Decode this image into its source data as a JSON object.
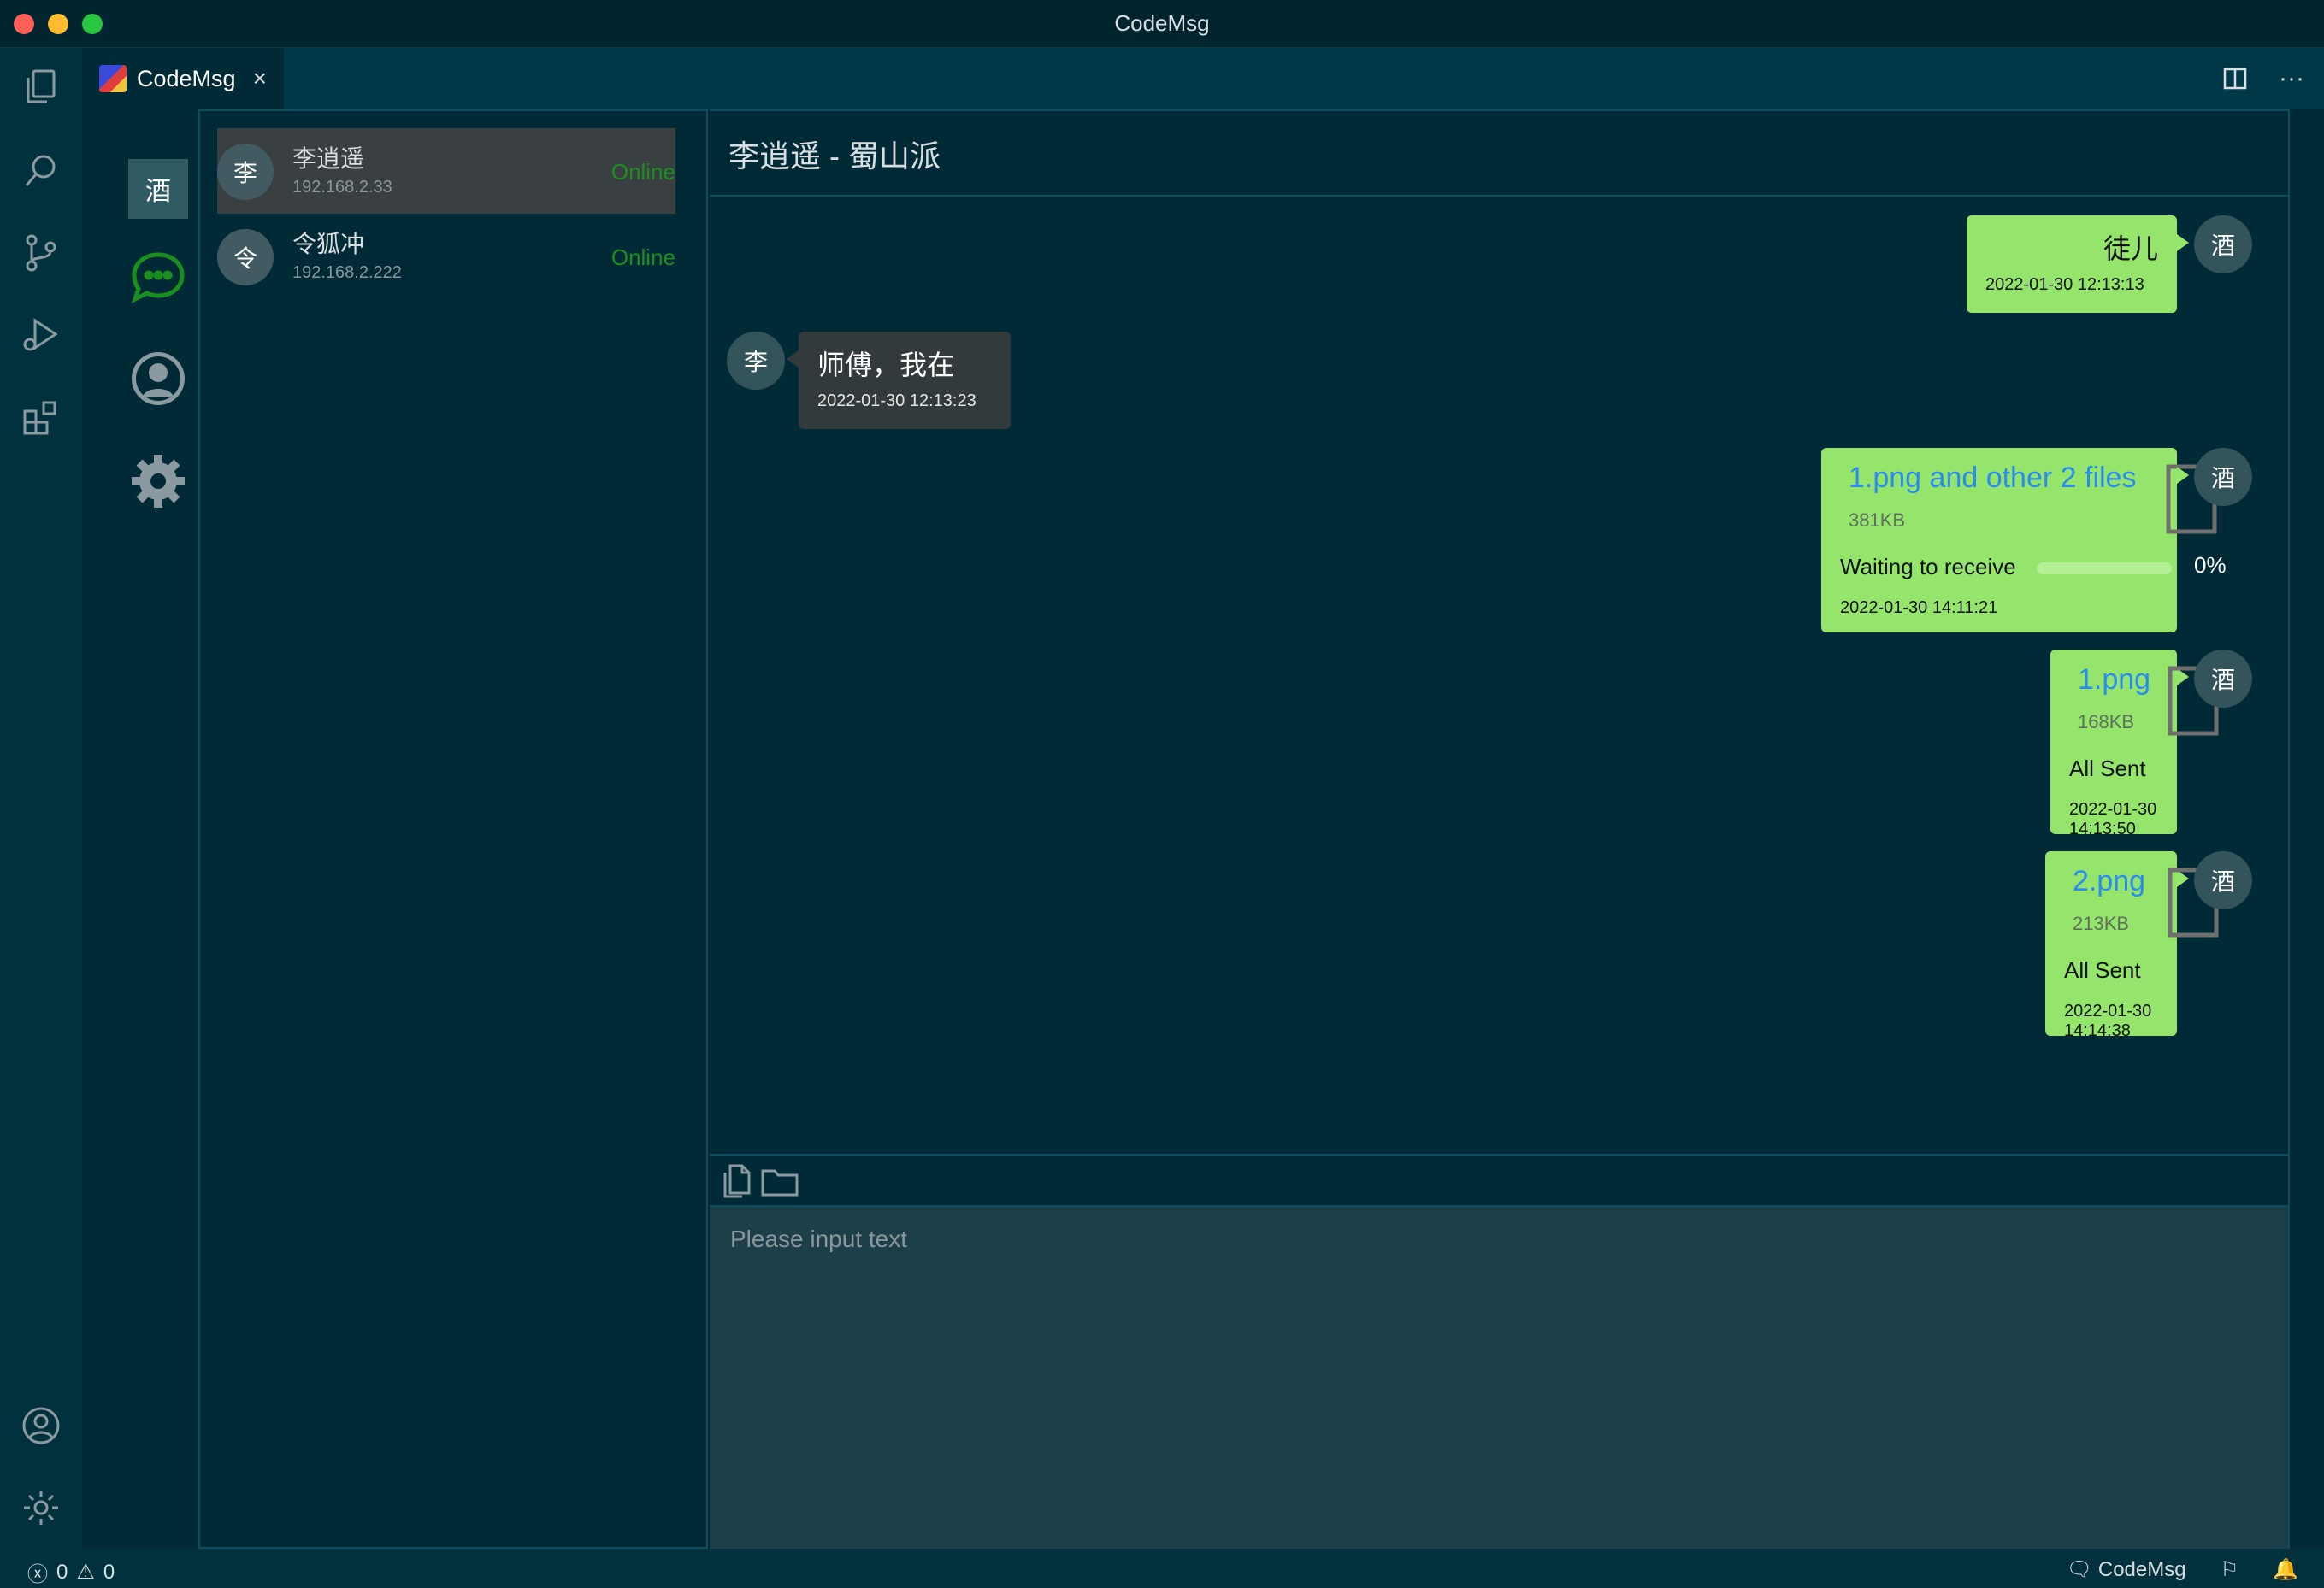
{
  "window": {
    "title": "CodeMsg"
  },
  "tab": {
    "label": "CodeMsg",
    "close": "×"
  },
  "tab_actions": {
    "split": "▯",
    "more": "···"
  },
  "nav": {
    "me_avatar": "酒"
  },
  "contacts": [
    {
      "avatar": "李",
      "name": "李逍遥",
      "ip": "192.168.2.33",
      "status": "Online",
      "active": true
    },
    {
      "avatar": "令",
      "name": "令狐冲",
      "ip": "192.168.2.222",
      "status": "Online",
      "active": false
    }
  ],
  "chat": {
    "title": "李逍遥 - 蜀山派",
    "messages": [
      {
        "type": "text",
        "mine": true,
        "avatar": "酒",
        "text": "徒儿",
        "time": "2022-01-30 12:13:13"
      },
      {
        "type": "text",
        "mine": false,
        "avatar": "李",
        "text": "师傅，我在",
        "time": "2022-01-30 12:13:23"
      },
      {
        "type": "file",
        "mine": true,
        "avatar": "酒",
        "name": "1.png and other 2 files",
        "size": "381KB",
        "status": "Waiting to receive",
        "progress": 0,
        "progress_label": "0%",
        "time": "2022-01-30 14:11:21"
      },
      {
        "type": "file",
        "mine": true,
        "avatar": "酒",
        "name": "1.png",
        "size": "168KB",
        "status": "All Sent",
        "time": "2022-01-30 14:13:50"
      },
      {
        "type": "file",
        "mine": true,
        "avatar": "酒",
        "name": "2.png",
        "size": "213KB",
        "status": "All Sent",
        "time": "2022-01-30 14:14:38"
      }
    ],
    "input_placeholder": "Please input text"
  },
  "statusbar": {
    "errors": "0",
    "warnings": "0",
    "app": "CodeMsg"
  },
  "colors": {
    "bg": "#002b36",
    "mine_bubble": "#95e56c",
    "their_bubble": "#333a3c",
    "online": "#1a8f1f",
    "link": "#2a8cf0"
  }
}
